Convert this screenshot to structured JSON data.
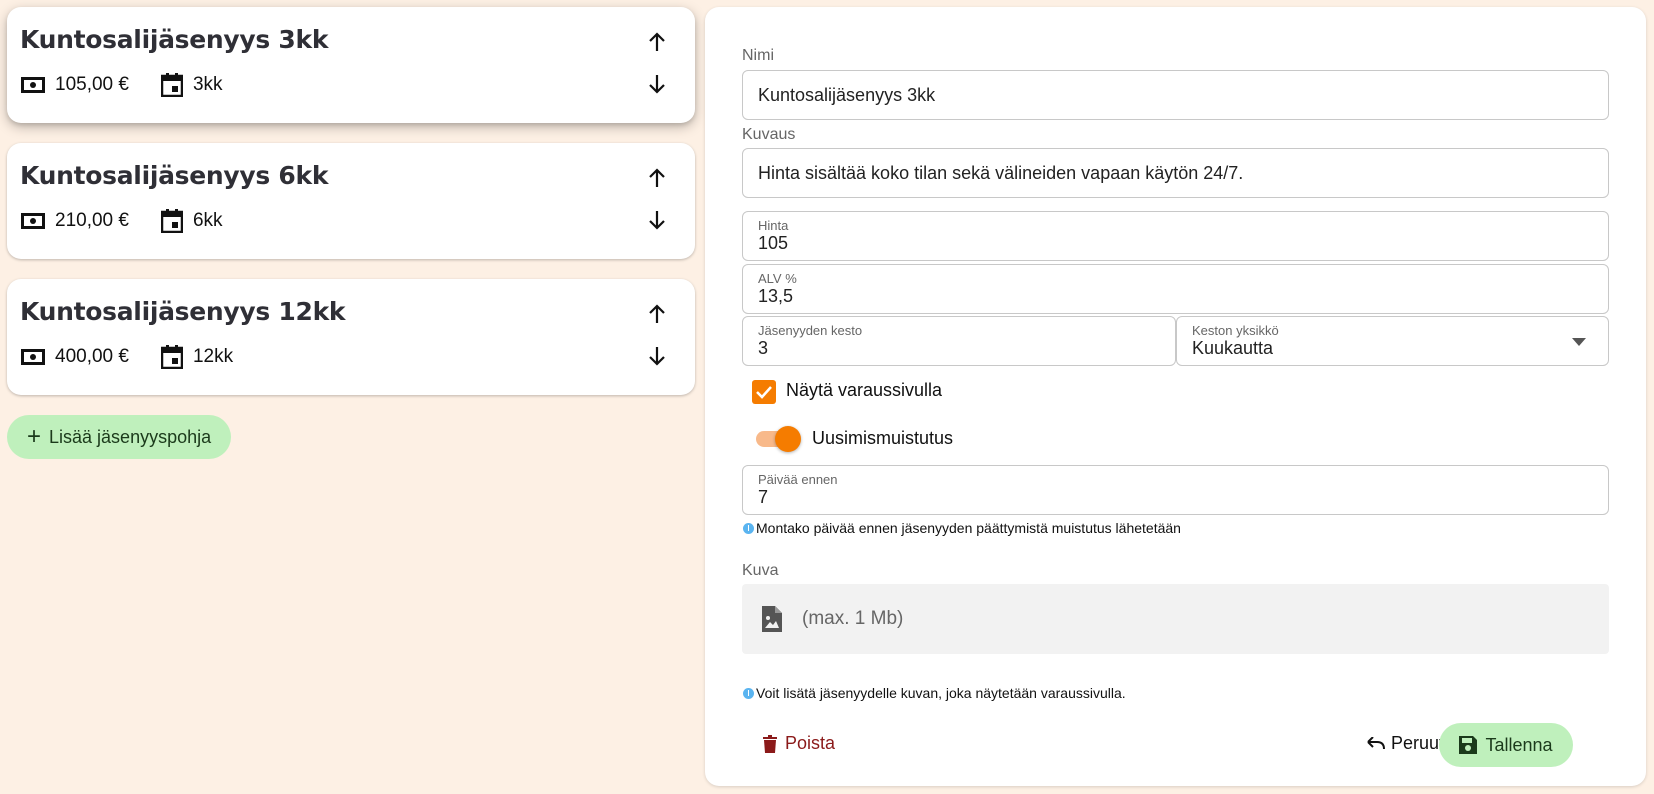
{
  "templates": [
    {
      "title": "Kuntosalijäsenyys 3kk",
      "price": "105,00 €",
      "duration": "3kk"
    },
    {
      "title": "Kuntosalijäsenyys 6kk",
      "price": "210,00 €",
      "duration": "6kk"
    },
    {
      "title": "Kuntosalijäsenyys 12kk",
      "price": "400,00 €",
      "duration": "12kk"
    }
  ],
  "add_button_label": "Lisää jäsenyyspohja",
  "form": {
    "name_label": "Nimi",
    "name_value": "Kuntosalijäsenyys 3kk",
    "description_label": "Kuvaus",
    "description_value": "Hinta sisältää koko tilan sekä välineiden vapaan käytön 24/7.",
    "price_label": "Hinta",
    "price_value": "105",
    "vat_label": "ALV %",
    "vat_value": "13,5",
    "duration_label": "Jäsenyyden kesto",
    "duration_value": "3",
    "unit_label": "Keston yksikkö",
    "unit_value": "Kuukautta",
    "show_on_booking_label": "Näytä varaussivulla",
    "show_on_booking_checked": true,
    "renewal_reminder_label": "Uusimismuistutus",
    "renewal_reminder_on": true,
    "days_before_label": "Päivää ennen",
    "days_before_value": "7",
    "days_before_hint": "Montako päivää ennen jäsenyyden päättymistä muistutus lähetetään",
    "image_label": "Kuva",
    "image_upload_text": "(max. 1 Mb)",
    "image_hint": "Voit lisätä jäsenyydelle kuvan, joka näytetään varaussivulla.",
    "delete_label": "Poista",
    "cancel_label": "Peruuta",
    "save_label": "Tallenna"
  },
  "colors": {
    "background": "#fdf0e4",
    "accent_orange": "#f57c00",
    "save_green": "#bff0bc",
    "delete_red": "#8b1a1a",
    "info_blue": "#5ab4f0"
  },
  "icons": [
    "money-icon",
    "calendar-icon",
    "arrow-up-icon",
    "arrow-down-icon",
    "plus-icon",
    "image-file-icon",
    "delete-icon",
    "undo-icon",
    "save-icon",
    "info-icon",
    "dropdown-arrow-icon",
    "check-icon"
  ]
}
